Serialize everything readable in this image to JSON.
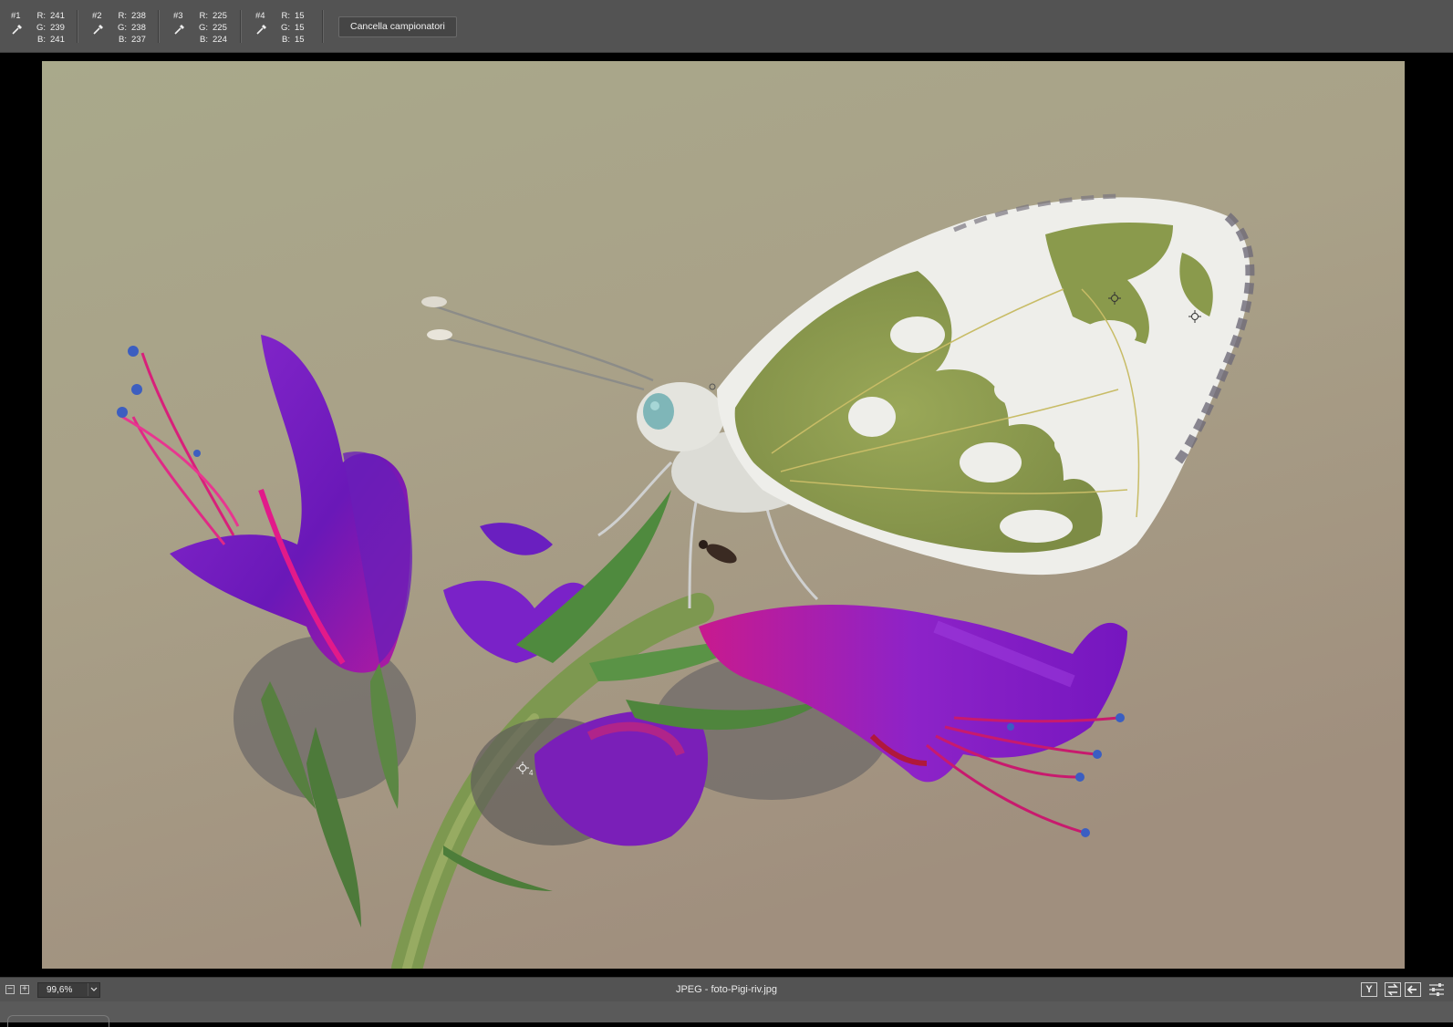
{
  "samplers": [
    {
      "label": "#1",
      "r": "241",
      "g": "239",
      "b": "241"
    },
    {
      "label": "#2",
      "r": "238",
      "g": "238",
      "b": "237"
    },
    {
      "label": "#3",
      "r": "225",
      "g": "225",
      "b": "224"
    },
    {
      "label": "#4",
      "r": "15",
      "g": "15",
      "b": "15"
    }
  ],
  "channel_labels": {
    "r": "R:",
    "g": "G:",
    "b": "B:"
  },
  "toolbar": {
    "clear_samplers_label": "Cancella campionatori"
  },
  "marker_labels": [
    "4"
  ],
  "statusbar": {
    "zoom_out_symbol": "−",
    "zoom_in_symbol": "+",
    "zoom_value": "99,6%",
    "file_info": "JPEG  -  foto-Pigi-riv.jpg",
    "icons": [
      "y-icon",
      "swap-icon",
      "back-arrow-icon",
      "settings-sliders-icon"
    ]
  },
  "colors": {
    "toolbar_bg": "#535353",
    "canvas_bg": "#000000",
    "background_blur_top": "#a9a98b",
    "background_blur_bottom": "#9f8d7b",
    "flower_purple": "#7a1fc4",
    "flower_magenta": "#d01e8e",
    "wing_green": "#8a9a4c",
    "wing_white": "#eeeeea"
  }
}
